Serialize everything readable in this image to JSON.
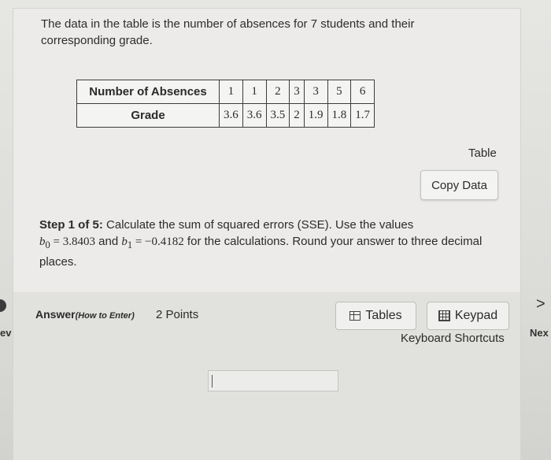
{
  "question": {
    "intro": "The data in the table is the number of absences for 7 students and their corresponding grade."
  },
  "table": {
    "rows": [
      {
        "label": "Number of Absences",
        "values": [
          "1",
          "1",
          "2",
          "3",
          "3",
          "5",
          "6"
        ]
      },
      {
        "label": "Grade",
        "values": [
          "3.6",
          "3.6",
          "3.5",
          "2",
          "1.9",
          "1.8",
          "1.7"
        ]
      }
    ],
    "table_link": "Table",
    "copy_data": "Copy Data"
  },
  "step": {
    "prefix": "Step 1 of 5:",
    "text1": " Calculate the sum of squared errors (SSE). Use the values",
    "b0_symbol": "b",
    "b0_sub": "0",
    "b0_value": " = 3.8403",
    "and": " and ",
    "b1_symbol": "b",
    "b1_sub": "1",
    "b1_value": " = −0.4182",
    "text2": " for the calculations. Round your answer to three decimal places."
  },
  "answer": {
    "label": "Answer",
    "how_to": "(How to Enter)",
    "points": "2 Points",
    "tables_button": "Tables",
    "keypad_button": "Keypad",
    "keyboard_shortcuts": "Keyboard Shortcuts",
    "input_value": ""
  },
  "navigation": {
    "prev_label": "ev",
    "next_label": "Nex",
    "next_arrow": ">"
  }
}
